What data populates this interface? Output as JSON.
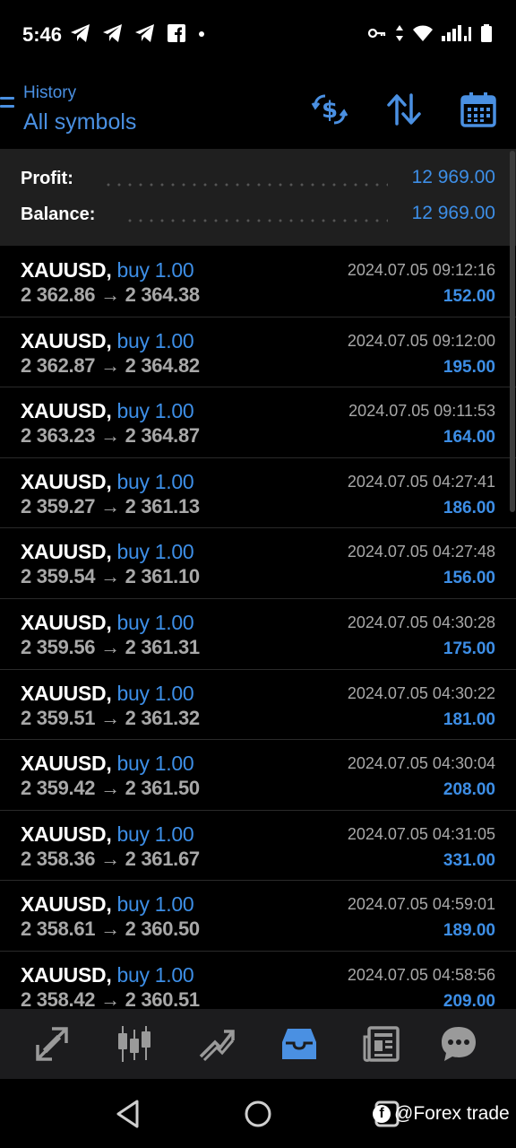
{
  "status_bar": {
    "time": "5:46",
    "left_icons": [
      "telegram-icon",
      "telegram-icon",
      "telegram-icon",
      "facebook-icon",
      "dot-icon"
    ],
    "right_icons": [
      "vpn-key-icon",
      "data-arrows-icon",
      "wifi-icon",
      "signal-icon",
      "battery-icon"
    ]
  },
  "header": {
    "subtitle": "History",
    "title": "All symbols",
    "icons": [
      "currency-exchange-icon",
      "sort-icon",
      "calendar-icon"
    ]
  },
  "summary": {
    "profit_label": "Profit:",
    "profit_value": "12 969.00",
    "balance_label": "Balance:",
    "balance_value": "12 969.00"
  },
  "trades": [
    {
      "symbol": "XAUUSD,",
      "side": "buy 1.00",
      "open": "2 362.86",
      "close": "2 364.38",
      "time": "2024.07.05 09:12:16",
      "profit": "152.00"
    },
    {
      "symbol": "XAUUSD,",
      "side": "buy 1.00",
      "open": "2 362.87",
      "close": "2 364.82",
      "time": "2024.07.05 09:12:00",
      "profit": "195.00"
    },
    {
      "symbol": "XAUUSD,",
      "side": "buy 1.00",
      "open": "2 363.23",
      "close": "2 364.87",
      "time": "2024.07.05 09:11:53",
      "profit": "164.00"
    },
    {
      "symbol": "XAUUSD,",
      "side": "buy 1.00",
      "open": "2 359.27",
      "close": "2 361.13",
      "time": "2024.07.05 04:27:41",
      "profit": "186.00"
    },
    {
      "symbol": "XAUUSD,",
      "side": "buy 1.00",
      "open": "2 359.54",
      "close": "2 361.10",
      "time": "2024.07.05 04:27:48",
      "profit": "156.00"
    },
    {
      "symbol": "XAUUSD,",
      "side": "buy 1.00",
      "open": "2 359.56",
      "close": "2 361.31",
      "time": "2024.07.05 04:30:28",
      "profit": "175.00"
    },
    {
      "symbol": "XAUUSD,",
      "side": "buy 1.00",
      "open": "2 359.51",
      "close": "2 361.32",
      "time": "2024.07.05 04:30:22",
      "profit": "181.00"
    },
    {
      "symbol": "XAUUSD,",
      "side": "buy 1.00",
      "open": "2 359.42",
      "close": "2 361.50",
      "time": "2024.07.05 04:30:04",
      "profit": "208.00"
    },
    {
      "symbol": "XAUUSD,",
      "side": "buy 1.00",
      "open": "2 358.36",
      "close": "2 361.67",
      "time": "2024.07.05 04:31:05",
      "profit": "331.00"
    },
    {
      "symbol": "XAUUSD,",
      "side": "buy 1.00",
      "open": "2 358.61",
      "close": "2 360.50",
      "time": "2024.07.05 04:59:01",
      "profit": "189.00"
    },
    {
      "symbol": "XAUUSD,",
      "side": "buy 1.00",
      "open": "2 358.42",
      "close": "2 360.51",
      "time": "2024.07.05 04:58:56",
      "profit": "209.00"
    }
  ],
  "arrow": "→",
  "tabbar": {
    "tabs": [
      "quotes-icon",
      "chart-icon",
      "trade-icon",
      "history-icon",
      "news-icon",
      "chat-icon"
    ],
    "active": "history-icon"
  },
  "watermark": "@Forex trade",
  "colors": {
    "accent": "#3d8ee6",
    "background": "#000000",
    "summary_bg": "#1f1f1f",
    "tabbar_bg": "#1c1c1e",
    "muted_text": "#a8a8a8"
  }
}
